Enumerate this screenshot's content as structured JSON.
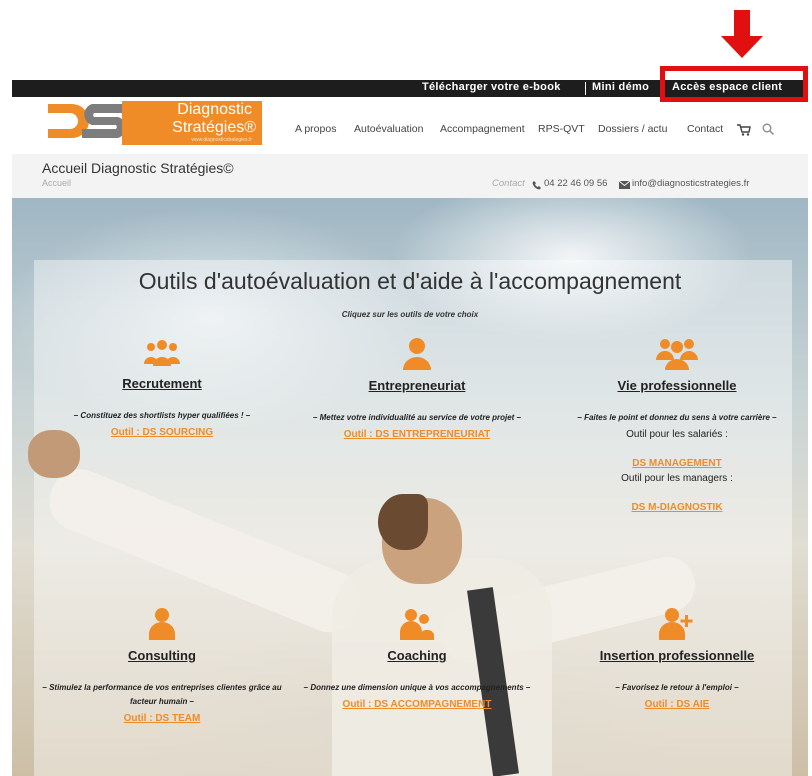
{
  "topbar": {
    "ebook": "Télécharger votre e-book",
    "demo": "Mini démo",
    "client": "Accès espace client"
  },
  "logo": {
    "line1": "Diagnostic",
    "line2": "Stratégies®",
    "tagline": "www.diagnosticstrategies.fr"
  },
  "nav": {
    "items": [
      "A propos",
      "Autoévaluation",
      "Accompagnement",
      "RPS-QVT",
      "Dossiers / actu",
      "Contact"
    ]
  },
  "breadcrumb": {
    "title": "Accueil Diagnostic Stratégies©",
    "crumb": "Accueil"
  },
  "contact": {
    "label": "Contact",
    "phone": "04 22 46 09 56",
    "email": "info@diagnosticstrategies.fr"
  },
  "content": {
    "title": "Outils d'autoévaluation et d'aide à l'accompagnement",
    "subtitle": "Cliquez sur les outils de votre choix"
  },
  "cards": {
    "recrutement": {
      "heading": "Recrutement",
      "desc": "– Constituez des shortlists hyper qualifiées ! –",
      "link": "Outil : DS SOURCING"
    },
    "entrepreneuriat": {
      "heading": "Entrepreneuriat",
      "desc": "– Mettez votre individualité au service de votre projet –",
      "link": "Outil : DS ENTREPRENEURIAT"
    },
    "vie": {
      "heading": "Vie professionnelle",
      "desc": "– Faites le point et donnez du sens à votre carrière –",
      "plain1": "Outil pour les salariés :",
      "link1": "DS MANAGEMENT",
      "plain2": "Outil pour les managers :",
      "link2": "DS M-DIAGNOSTIK"
    },
    "consulting": {
      "heading": "Consulting",
      "desc": "– Stimulez la performance de vos entreprises clientes grâce au facteur humain –",
      "link": "Outil : DS TEAM"
    },
    "coaching": {
      "heading": "Coaching",
      "desc": "– Donnez une dimension unique à vos accompagnements –",
      "link": "Outil : DS ACCOMPAGNEMENT"
    },
    "insertion": {
      "heading": "Insertion professionnelle",
      "desc": "– Favorisez le retour à l'emploi –",
      "link": "Outil : DS AIE"
    }
  },
  "colors": {
    "accent": "#ef8c27",
    "topbar": "#1d1d1d",
    "annotation": "#e10f0f"
  },
  "icons": [
    "cart-icon",
    "search-icon",
    "phone-icon",
    "mail-icon",
    "group-icon",
    "person-icon",
    "team-icon",
    "pair-icon",
    "person-plus-icon"
  ]
}
